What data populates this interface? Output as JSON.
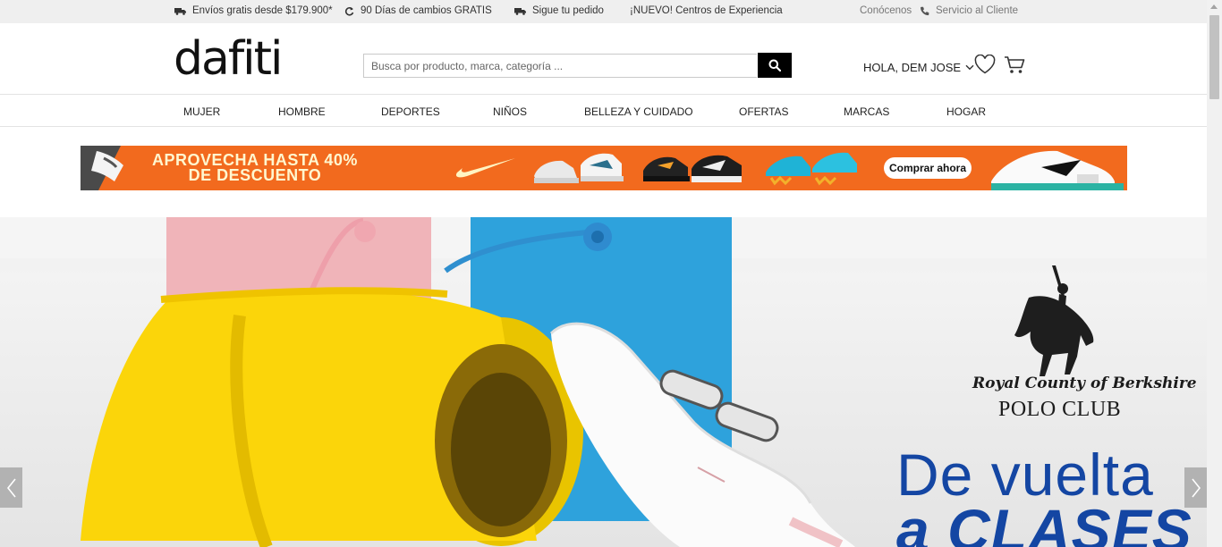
{
  "topbar": {
    "shipping": "Envíos gratis desde $179.900*",
    "returns": "90 Días de cambios GRATIS",
    "track": "Sigue tu pedido",
    "experience": "¡NUEVO! Centros de Experiencia",
    "about": "Conócenos",
    "support": "Servicio al Cliente"
  },
  "header": {
    "logo": "dafiti",
    "search_placeholder": "Busca por producto, marca, categoría ...",
    "greeting": "HOLA, DEM JOSE"
  },
  "nav": {
    "items": [
      "MUJER",
      "HOMBRE",
      "DEPORTES",
      "NIÑOS",
      "BELLEZA Y CUIDADO",
      "OFERTAS",
      "MARCAS",
      "HOGAR"
    ]
  },
  "promo": {
    "line1": "APROVECHA HASTA 40%",
    "line2": "DE DESCUENTO",
    "cta": "Comprar ahora"
  },
  "hero": {
    "brand_line1": "Royal County of Berkshire",
    "brand_line2": "POLO CLUB",
    "headline1": "De vuelta",
    "headline2": "a CLASES"
  },
  "colors": {
    "promo_orange": "#f26a1e",
    "headline_blue": "#1446a3",
    "topbar_bg": "#efefef"
  },
  "icons": {
    "truck": "truck-icon",
    "returns": "refresh-icon",
    "phone": "phone-icon",
    "search": "search-icon",
    "heart": "heart-icon",
    "cart": "cart-icon"
  }
}
